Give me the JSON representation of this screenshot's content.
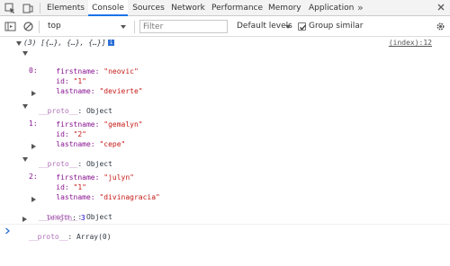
{
  "tabs": [
    "Elements",
    "Console",
    "Sources",
    "Network",
    "Performance",
    "Memory",
    "Application"
  ],
  "active_tab": "Console",
  "more_tabs_label": "»",
  "toolbar": {
    "context": "top",
    "filter_placeholder": "Filter",
    "levels_label": "Default levels",
    "group_similar_label": "Group similar",
    "group_similar_checked": true
  },
  "console": {
    "array_summary": "(3) [{…}, {…}, {…}]",
    "info_badge": "i",
    "source": "(index):12",
    "items": [
      {
        "index": "0:",
        "firstname": "\"neovic\"",
        "id": "\"1\"",
        "lastname": "\"devierte\""
      },
      {
        "index": "1:",
        "firstname": "\"gemalyn\"",
        "id": "\"2\"",
        "lastname": "\"cepe\""
      },
      {
        "index": "2:",
        "firstname": "\"julyn\"",
        "id": "\"1\"",
        "lastname": "\"divinagracia\""
      }
    ],
    "labels": {
      "firstname": "firstname: ",
      "id": "id: ",
      "lastname": "lastname: ",
      "proto": "__proto__",
      "proto_object": ": Object",
      "length_key": "length",
      "length_value": "3",
      "proto_array": ": Array(0)"
    }
  },
  "icons": {
    "dock": "dock-side-icon",
    "inspect": "inspect-element-icon",
    "mobile": "device-toolbar-icon",
    "sidebar": "show-console-sidebar-icon",
    "clear": "clear-console-icon",
    "settings": "settings-gear-icon",
    "close": "close-icon",
    "prompt": "prompt-chevron-icon"
  }
}
